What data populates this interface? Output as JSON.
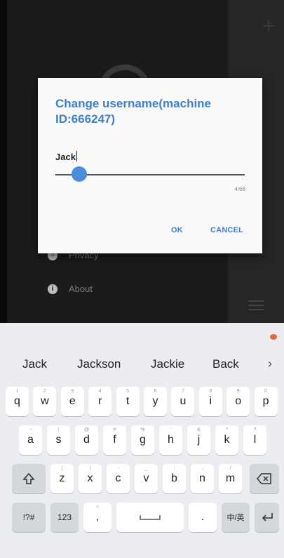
{
  "dialog": {
    "title": "Change username(machine ID:666247)",
    "value": "Jack",
    "counter": "4/66",
    "ok_label": "OK",
    "cancel_label": "CANCEL"
  },
  "menu": {
    "privacy_label": "Privacy",
    "about_label": "About"
  },
  "keyboard": {
    "suggestions": [
      "Jack",
      "Jackson",
      "Jackie",
      "Back"
    ],
    "more_icon": "chevron-right-icon",
    "row1": [
      {
        "label": "q",
        "hint": "1"
      },
      {
        "label": "w",
        "hint": "2"
      },
      {
        "label": "e",
        "hint": "3"
      },
      {
        "label": "r",
        "hint": "4"
      },
      {
        "label": "t",
        "hint": "5"
      },
      {
        "label": "y",
        "hint": "6"
      },
      {
        "label": "u",
        "hint": "7"
      },
      {
        "label": "i",
        "hint": "8"
      },
      {
        "label": "o",
        "hint": "9"
      },
      {
        "label": "p",
        "hint": "0"
      }
    ],
    "row2": [
      {
        "label": "a",
        "hint": "~"
      },
      {
        "label": "s",
        "hint": "!"
      },
      {
        "label": "d",
        "hint": "@"
      },
      {
        "label": "f",
        "hint": "#"
      },
      {
        "label": "g",
        "hint": "%"
      },
      {
        "label": "h",
        "hint": "'"
      },
      {
        "label": "j",
        "hint": "&"
      },
      {
        "label": "k",
        "hint": "*"
      },
      {
        "label": "l",
        "hint": "?"
      }
    ],
    "row3": [
      {
        "label": "z",
        "hint": "("
      },
      {
        "label": "x",
        "hint": ")"
      },
      {
        "label": "c",
        "hint": "-"
      },
      {
        "label": "v",
        "hint": "_"
      },
      {
        "label": "b",
        "hint": ":"
      },
      {
        "label": "n",
        "hint": ";"
      },
      {
        "label": "m",
        "hint": "/"
      }
    ],
    "shift_icon": "shift-icon",
    "backspace_icon": "backspace-icon",
    "symbols_label": "!?#",
    "numbers_label": "123",
    "comma_label": ",",
    "period_label": ".",
    "lang_label": "中/英",
    "enter_icon": "enter-icon"
  }
}
